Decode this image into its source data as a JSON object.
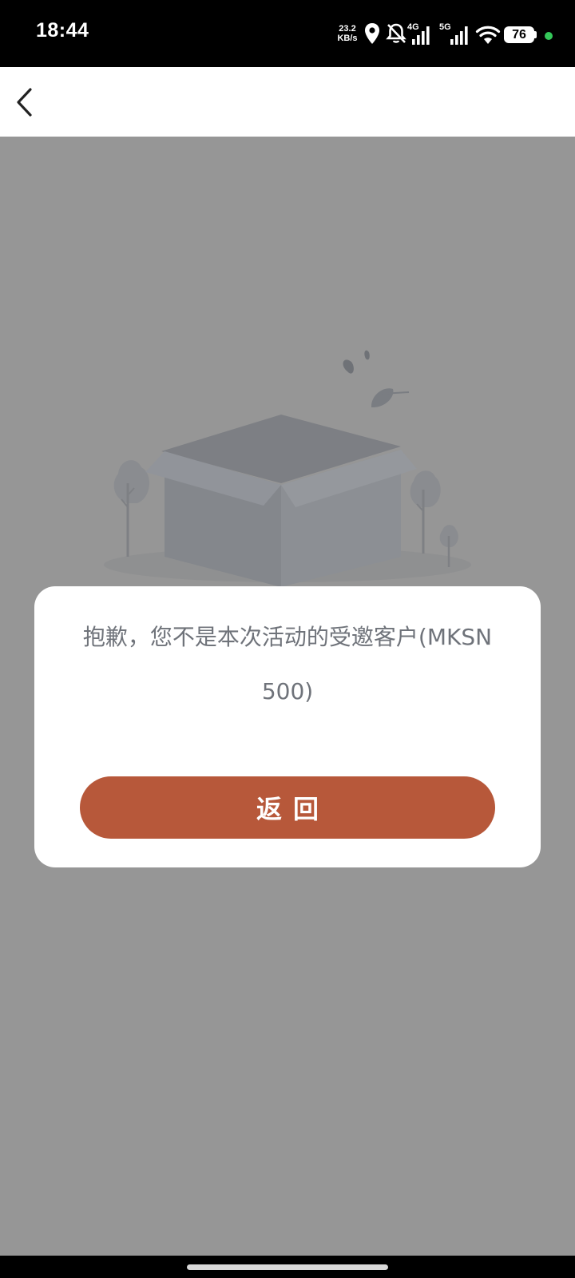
{
  "status_bar": {
    "time": "18:44",
    "network_speed_value": "23.2",
    "network_speed_unit": "KB/s",
    "signal_1_label": "4G",
    "signal_2_label": "5G",
    "battery": "76",
    "icons": [
      "location-icon",
      "bell-off-icon",
      "signal-4g-icon",
      "signal-5g-icon",
      "wifi-icon",
      "battery-icon",
      "status-dot-icon"
    ]
  },
  "header": {
    "back_icon": "chevron-left-icon"
  },
  "illustration": {
    "icon": "empty-box-icon"
  },
  "dialog": {
    "message": "抱歉，您不是本次活动的受邀客户(MKSN500)",
    "return_label": "返回"
  },
  "colors": {
    "overlay": "#969696",
    "button": "#b7583a",
    "message_text": "#6f737a"
  }
}
